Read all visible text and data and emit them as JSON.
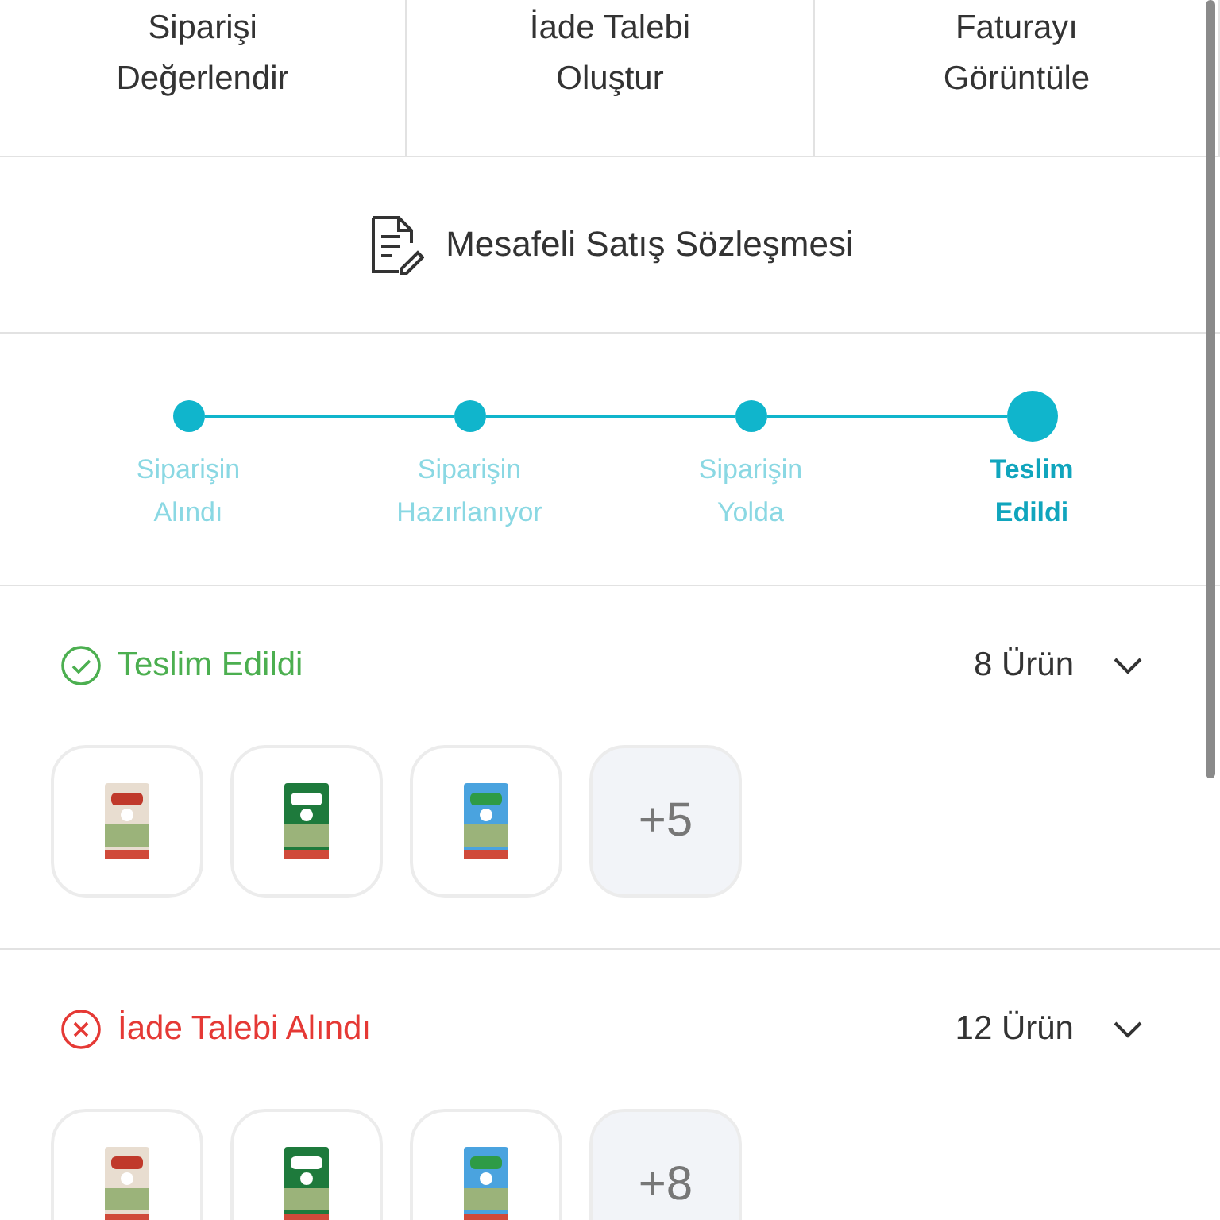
{
  "actions": [
    {
      "label": "Siparişi\nDeğerlendir"
    },
    {
      "label": "İade Talebi\nOluştur"
    },
    {
      "label": "Faturayı\nGörüntüle"
    }
  ],
  "contract": {
    "label": "Mesafeli Satış Sözleşmesi"
  },
  "steps": [
    {
      "label": "Siparişin\nAlındı",
      "current": false
    },
    {
      "label": "Siparişin\nHazırlanıyor",
      "current": false
    },
    {
      "label": "Siparişin\nYolda",
      "current": false
    },
    {
      "label": "Teslim\nEdildi",
      "current": true
    }
  ],
  "groups": [
    {
      "kind": "delivered",
      "status": "Teslim Edildi",
      "count": "8 Ürün",
      "expanded": false,
      "more": "+5"
    },
    {
      "kind": "returned",
      "status": "İade Talebi Alındı",
      "count": "12 Ürün",
      "expanded": false,
      "more": "+8"
    }
  ]
}
